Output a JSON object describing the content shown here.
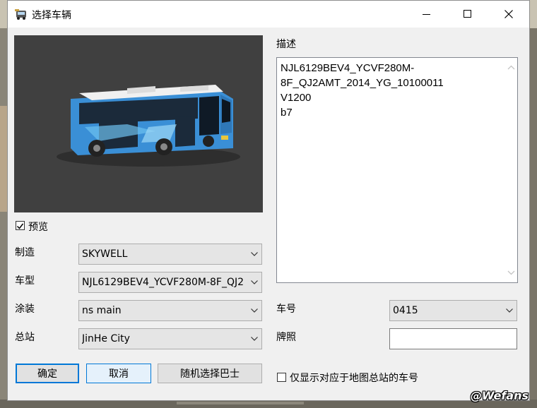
{
  "window": {
    "title": "选择车辆"
  },
  "preview": {
    "checkbox_label": "预览",
    "checked": true
  },
  "fields": {
    "manufacturer_label": "制造",
    "manufacturer_value": "SKYWELL",
    "model_label": "车型",
    "model_value": "NJL6129BEV4_YCVF280M-8F_QJ2",
    "livery_label": "涂装",
    "livery_value": "ns main",
    "depot_label": "总站",
    "depot_value": "JinHe City"
  },
  "buttons": {
    "ok": "确定",
    "cancel": "取消",
    "random": "随机选择巴士"
  },
  "description": {
    "label": "描述",
    "lines": [
      "NJL6129BEV4_YCVF280M-",
      "8F_QJ2AMT_2014_YG_10100011",
      "V1200",
      "b7"
    ]
  },
  "right_fields": {
    "fleet_number_label": "车号",
    "fleet_number_value": "0415",
    "plate_label": "牌照",
    "plate_value": ""
  },
  "filter": {
    "label": "仅显示对应于地图总站的车号",
    "checked": false
  },
  "watermark": "@Wefans",
  "colors": {
    "bus_body": "#3a8fd6",
    "preview_bg": "#404040",
    "accent": "#0078d7"
  }
}
